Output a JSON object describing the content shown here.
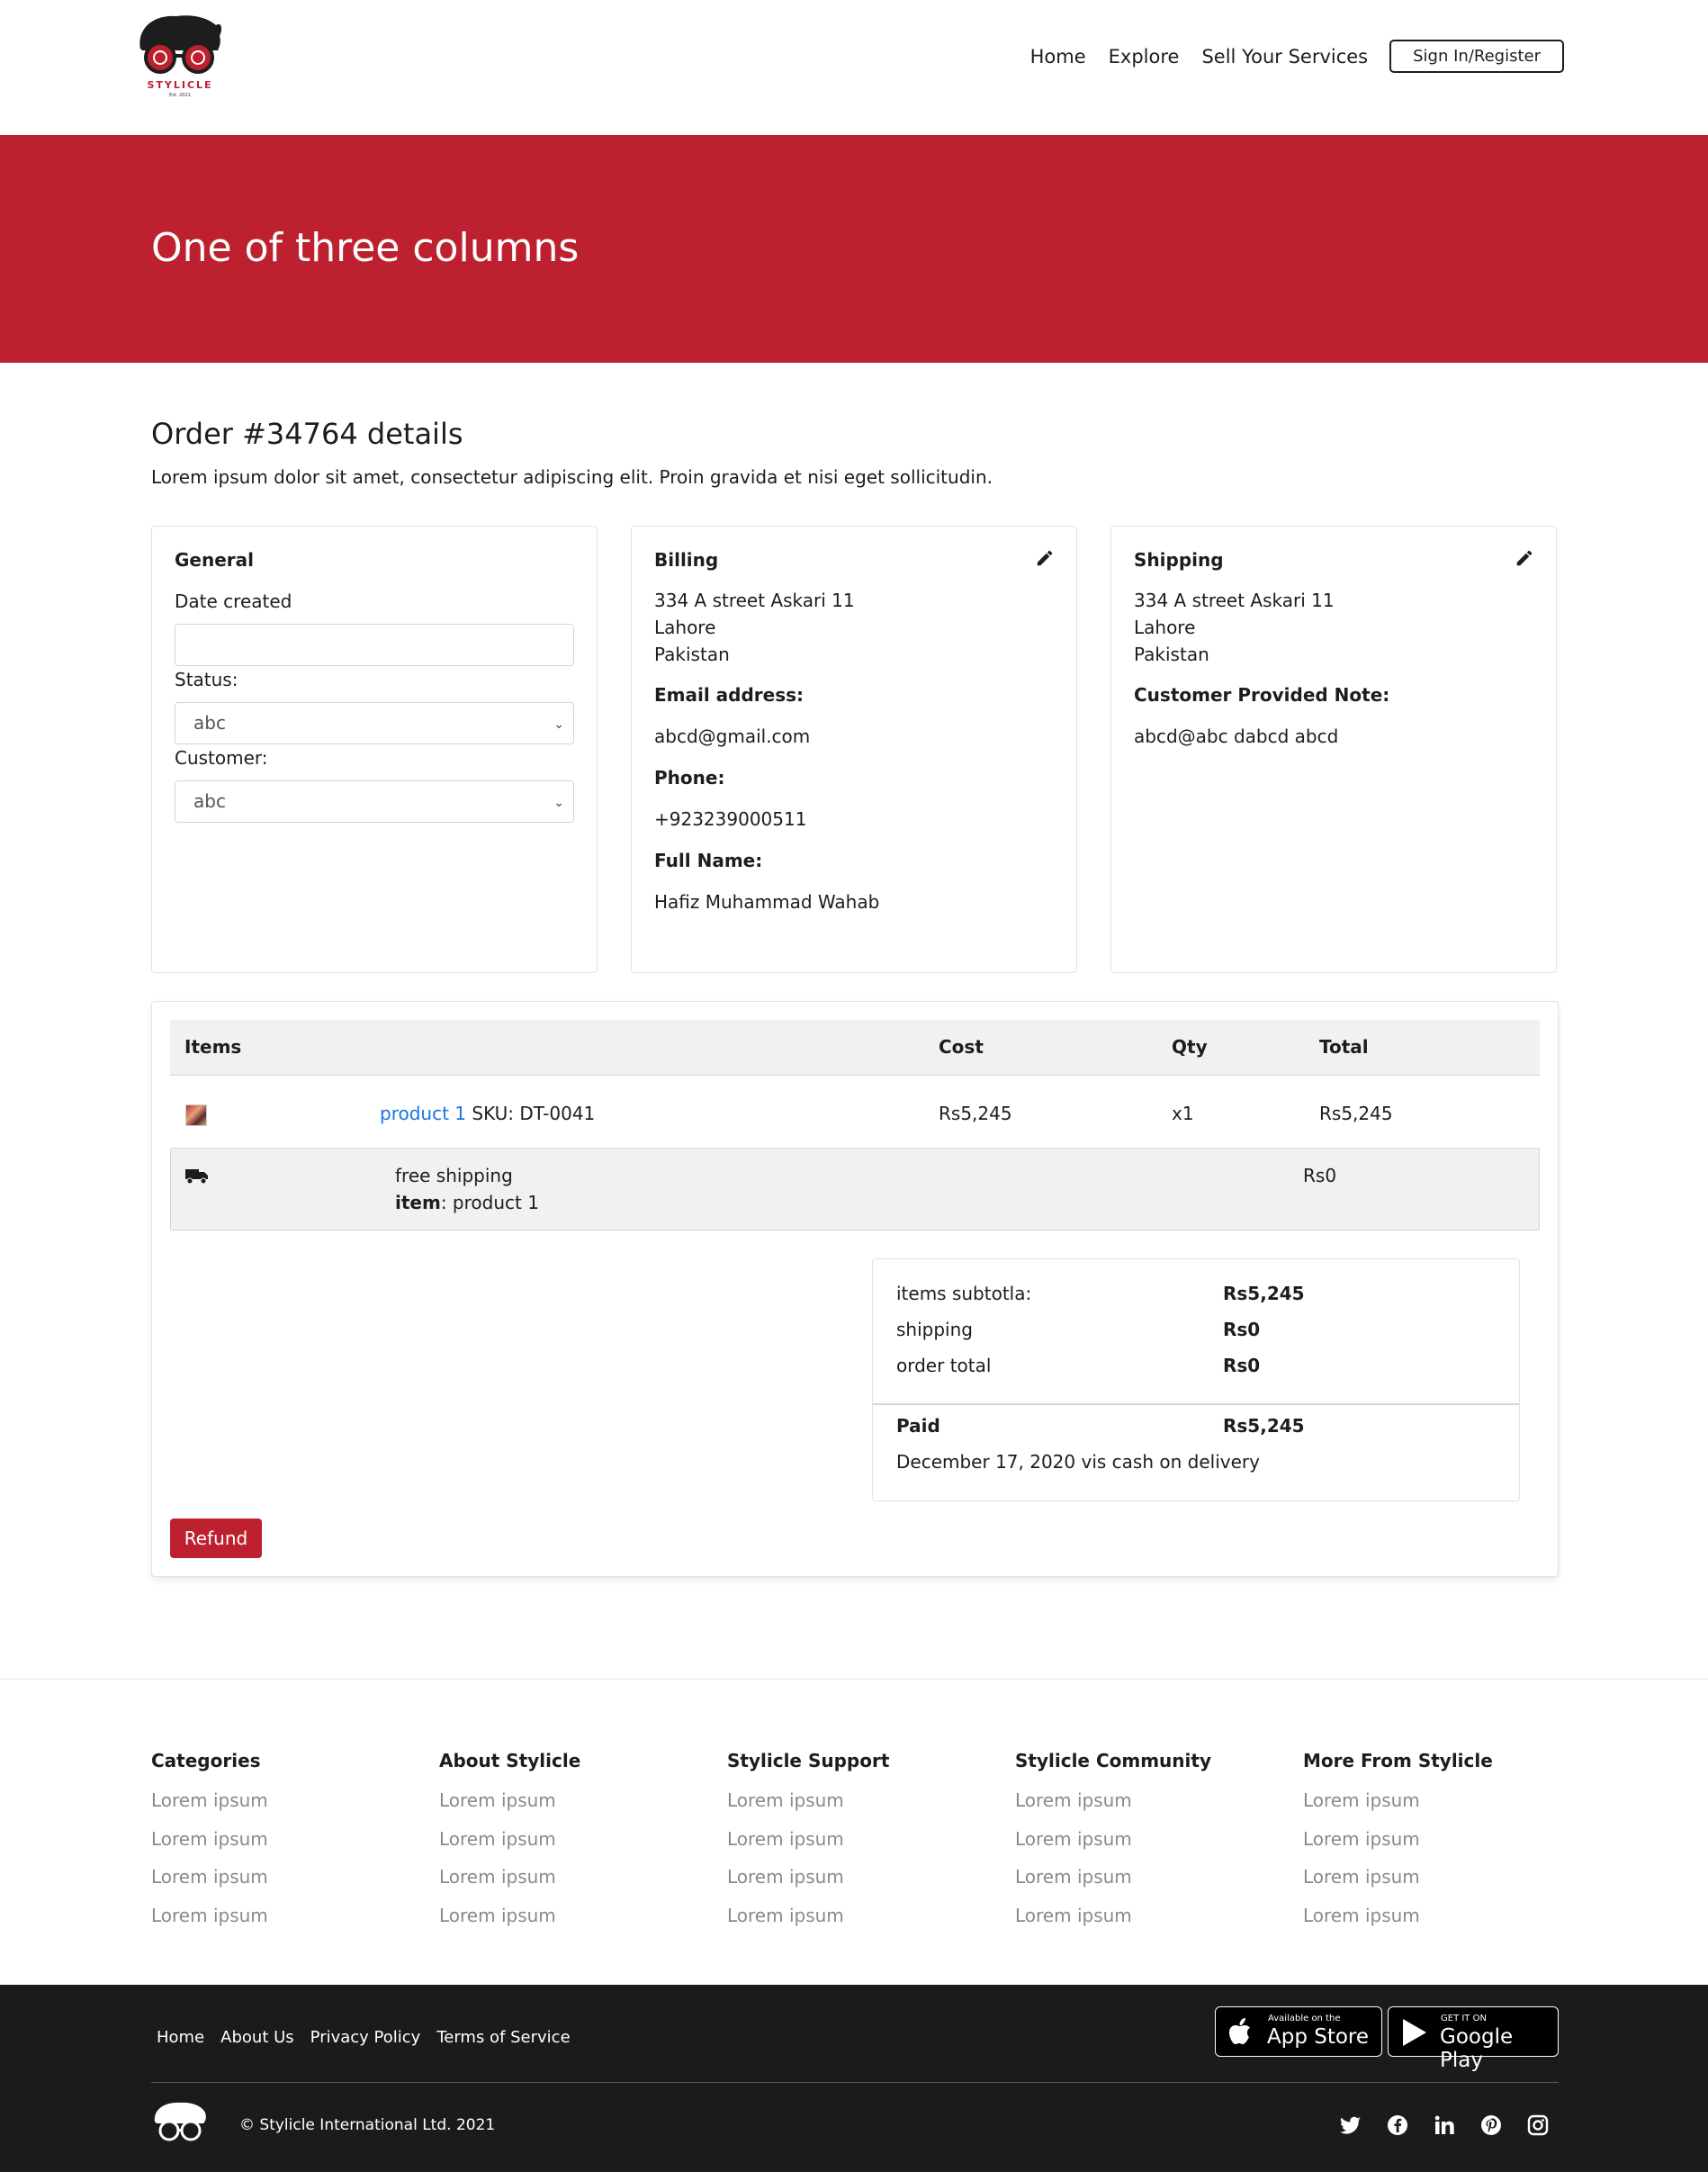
{
  "header": {
    "brand": "STYLICLE",
    "brand_est": "Est. 2021",
    "nav": [
      "Home",
      "Explore",
      "Sell Your Services"
    ],
    "signin": "Sign In/Register"
  },
  "hero": {
    "title": "One of three columns"
  },
  "order": {
    "title": "Order #34764 details",
    "description": "Lorem ipsum dolor sit amet, consectetur adipiscing elit. Proin gravida et nisi eget sollicitudin."
  },
  "general": {
    "title": "General",
    "date_label": "Date created",
    "date_value": "",
    "status_label": "Status:",
    "status_value": "abc",
    "customer_label": "Customer:",
    "customer_value": "abc"
  },
  "billing": {
    "title": "Billing",
    "address": [
      "334 A street Askari 11",
      "Lahore",
      "Pakistan"
    ],
    "email_label": "Email address:",
    "email": "abcd@gmail.com",
    "phone_label": "Phone:",
    "phone": "+923239000511",
    "name_label": "Full Name:",
    "name": "Hafiz Muhammad Wahab"
  },
  "shipping": {
    "title": "Shipping",
    "address": [
      "334 A street Askari 11",
      "Lahore",
      "Pakistan"
    ],
    "note_label": "Customer Provided Note:",
    "note": "abcd@abc dabcd abcd"
  },
  "items": {
    "headers": {
      "items": "Items",
      "cost": "Cost",
      "qty": "Qty",
      "total": "Total"
    },
    "rows": [
      {
        "product": "product 1",
        "sku": " SKU: DT-0041",
        "cost": "Rs5,245",
        "qty": "x1",
        "total": "Rs5,245"
      }
    ],
    "shipping_row": {
      "method": "free shipping",
      "item_label": "item",
      "item_value": ": product 1",
      "cost": "Rs0"
    }
  },
  "totals": {
    "subtotal_label": "items subtotla:",
    "subtotal": "Rs5,245",
    "shipping_label": "shipping",
    "shipping": "Rs0",
    "order_total_label": "order total",
    "order_total": "Rs0",
    "paid_label": "Paid",
    "paid": "Rs5,245",
    "paid_note": "December 17, 2020 vis cash on delivery"
  },
  "refund_label": "Refund",
  "footer": {
    "columns": [
      {
        "title": "Categories",
        "links": [
          "Lorem ipsum",
          "Lorem ipsum",
          "Lorem ipsum",
          "Lorem ipsum"
        ]
      },
      {
        "title": "About Stylicle",
        "links": [
          "Lorem ipsum",
          "Lorem ipsum",
          "Lorem ipsum",
          "Lorem ipsum"
        ]
      },
      {
        "title": "Stylicle Support",
        "links": [
          "Lorem ipsum",
          "Lorem ipsum",
          "Lorem ipsum",
          "Lorem ipsum"
        ]
      },
      {
        "title": "Stylicle Community",
        "links": [
          "Lorem ipsum",
          "Lorem ipsum",
          "Lorem ipsum",
          "Lorem ipsum"
        ]
      },
      {
        "title": "More From Stylicle",
        "links": [
          "Lorem ipsum",
          "Lorem ipsum",
          "Lorem ipsum",
          "Lorem ipsum"
        ]
      }
    ],
    "bottom_nav": [
      "Home",
      "About Us",
      "Privacy Policy",
      "Terms of Service"
    ],
    "app_store": {
      "small": "Available on the",
      "big": "App Store"
    },
    "google_play": {
      "small": "GET IT ON",
      "big": "Google Play"
    },
    "copyright": "© Stylicle International Ltd. 2021",
    "social_icons": [
      "twitter-icon",
      "facebook-icon",
      "linkedin-icon",
      "pinterest-icon",
      "instagram-icon"
    ]
  },
  "colors": {
    "brand_red": "#bd2130",
    "footer_dark": "#1d1a1a",
    "link_blue": "#1a73e8"
  }
}
